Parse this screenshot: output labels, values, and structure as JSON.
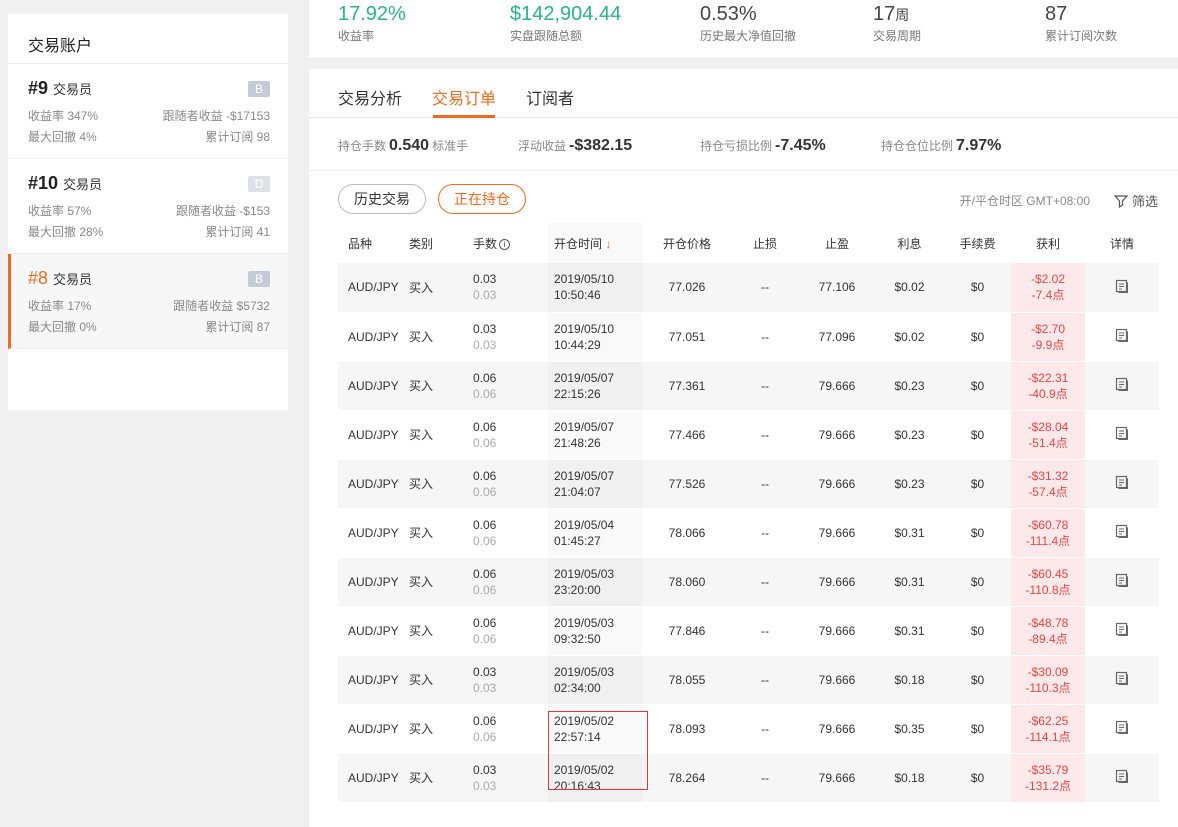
{
  "stats": {
    "yield": {
      "value": "17.92%",
      "label": "收益率"
    },
    "follow_total": {
      "value": "$142,904.44",
      "label": "实盘跟随总额"
    },
    "drawdown": {
      "value": "0.53%",
      "label": "历史最大净值回撤"
    },
    "period": {
      "value": "17",
      "unit": "周",
      "label": "交易周期"
    },
    "subs": {
      "value": "87",
      "label": "累计订阅次数"
    }
  },
  "sidebar": {
    "title": "交易账户",
    "accounts": [
      {
        "num": "#9",
        "role": "交易员",
        "grade": "B",
        "yield": "收益率 347%",
        "follower": "跟随者收益 -$17153",
        "drawdown": "最大回撤 4%",
        "subs": "累计订阅 98"
      },
      {
        "num": "#10",
        "role": "交易员",
        "grade": "D",
        "yield": "收益率 57%",
        "follower": "跟随者收益 -$153",
        "drawdown": "最大回撤 28%",
        "subs": "累计订阅 41"
      },
      {
        "num": "#8",
        "role": "交易员",
        "grade": "B",
        "yield": "收益率 17%",
        "follower": "跟随者收益 $5732",
        "drawdown": "最大回撤 0%",
        "subs": "累计订阅 87"
      }
    ]
  },
  "tabs": {
    "analysis": "交易分析",
    "orders": "交易订单",
    "subscribers": "订阅者"
  },
  "summary": {
    "lots_label": "持仓手数",
    "lots_value": "0.540",
    "lots_unit": "标准手",
    "float_label": "浮动收益",
    "float_value": "-$382.15",
    "pl_ratio_label": "持仓亏损比例",
    "pl_ratio_value": "-7.45%",
    "pos_ratio_label": "持仓仓位比例",
    "pos_ratio_value": "7.97%"
  },
  "filters": {
    "history": "历史交易",
    "open": "正在持仓",
    "timezone": "开/平仓时区 GMT+08:00",
    "filter": "筛选"
  },
  "table": {
    "headers": {
      "symbol": "品种",
      "type": "类别",
      "lots": "手数",
      "open_time": "开仓时间",
      "open_price": "开仓价格",
      "sl": "止损",
      "tp": "止盈",
      "interest": "利息",
      "fee": "手续费",
      "profit": "获利",
      "detail": "详情"
    },
    "rows": [
      {
        "symbol": "AUD/JPY",
        "type": "买入",
        "lots": "0.03",
        "lots2": "0.03",
        "date": "2019/05/10",
        "time": "10:50:46",
        "price": "77.026",
        "sl": "--",
        "tp": "77.106",
        "interest": "$0.02",
        "fee": "$0",
        "profit": "-$2.02",
        "points": "-7.4点"
      },
      {
        "symbol": "AUD/JPY",
        "type": "买入",
        "lots": "0.03",
        "lots2": "0.03",
        "date": "2019/05/10",
        "time": "10:44:29",
        "price": "77.051",
        "sl": "--",
        "tp": "77.096",
        "interest": "$0.02",
        "fee": "$0",
        "profit": "-$2.70",
        "points": "-9.9点"
      },
      {
        "symbol": "AUD/JPY",
        "type": "买入",
        "lots": "0.06",
        "lots2": "0.06",
        "date": "2019/05/07",
        "time": "22:15:26",
        "price": "77.361",
        "sl": "--",
        "tp": "79.666",
        "interest": "$0.23",
        "fee": "$0",
        "profit": "-$22.31",
        "points": "-40.9点"
      },
      {
        "symbol": "AUD/JPY",
        "type": "买入",
        "lots": "0.06",
        "lots2": "0.06",
        "date": "2019/05/07",
        "time": "21:48:26",
        "price": "77.466",
        "sl": "--",
        "tp": "79.666",
        "interest": "$0.23",
        "fee": "$0",
        "profit": "-$28.04",
        "points": "-51.4点"
      },
      {
        "symbol": "AUD/JPY",
        "type": "买入",
        "lots": "0.06",
        "lots2": "0.06",
        "date": "2019/05/07",
        "time": "21:04:07",
        "price": "77.526",
        "sl": "--",
        "tp": "79.666",
        "interest": "$0.23",
        "fee": "$0",
        "profit": "-$31.32",
        "points": "-57.4点"
      },
      {
        "symbol": "AUD/JPY",
        "type": "买入",
        "lots": "0.06",
        "lots2": "0.06",
        "date": "2019/05/04",
        "time": "01:45:27",
        "price": "78.066",
        "sl": "--",
        "tp": "79.666",
        "interest": "$0.31",
        "fee": "$0",
        "profit": "-$60.78",
        "points": "-111.4点"
      },
      {
        "symbol": "AUD/JPY",
        "type": "买入",
        "lots": "0.06",
        "lots2": "0.06",
        "date": "2019/05/03",
        "time": "23:20:00",
        "price": "78.060",
        "sl": "--",
        "tp": "79.666",
        "interest": "$0.31",
        "fee": "$0",
        "profit": "-$60.45",
        "points": "-110.8点"
      },
      {
        "symbol": "AUD/JPY",
        "type": "买入",
        "lots": "0.06",
        "lots2": "0.06",
        "date": "2019/05/03",
        "time": "09:32:50",
        "price": "77.846",
        "sl": "--",
        "tp": "79.666",
        "interest": "$0.31",
        "fee": "$0",
        "profit": "-$48.78",
        "points": "-89.4点"
      },
      {
        "symbol": "AUD/JPY",
        "type": "买入",
        "lots": "0.03",
        "lots2": "0.03",
        "date": "2019/05/03",
        "time": "02:34:00",
        "price": "78.055",
        "sl": "--",
        "tp": "79.666",
        "interest": "$0.18",
        "fee": "$0",
        "profit": "-$30.09",
        "points": "-110.3点"
      },
      {
        "symbol": "AUD/JPY",
        "type": "买入",
        "lots": "0.06",
        "lots2": "0.06",
        "date": "2019/05/02",
        "time": "22:57:14",
        "price": "78.093",
        "sl": "--",
        "tp": "79.666",
        "interest": "$0.35",
        "fee": "$0",
        "profit": "-$62.25",
        "points": "-114.1点"
      },
      {
        "symbol": "AUD/JPY",
        "type": "买入",
        "lots": "0.03",
        "lots2": "0.03",
        "date": "2019/05/02",
        "time": "20:16:43",
        "price": "78.264",
        "sl": "--",
        "tp": "79.666",
        "interest": "$0.18",
        "fee": "$0",
        "profit": "-$35.79",
        "points": "-131.2点"
      }
    ]
  },
  "colors": {
    "accent": "#f06b1e",
    "green": "#2bb28a",
    "loss": "#e54545"
  }
}
